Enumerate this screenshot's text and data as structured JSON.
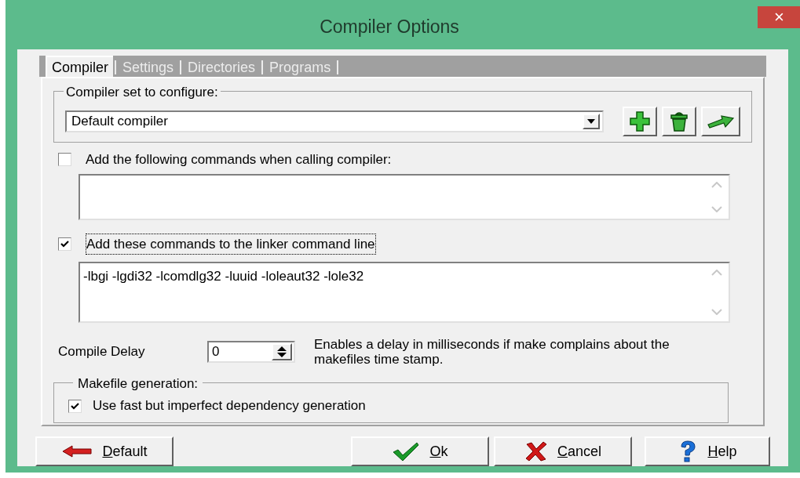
{
  "window": {
    "title": "Compiler Options",
    "close": "×"
  },
  "tabs": [
    {
      "label": "Compiler",
      "selected": true
    },
    {
      "label": "Settings",
      "selected": false
    },
    {
      "label": "Directories",
      "selected": false
    },
    {
      "label": "Programs",
      "selected": false
    }
  ],
  "compiler_set": {
    "label": "Compiler set to configure:",
    "value": "Default compiler"
  },
  "compile_commands": {
    "label": "Add the following commands when calling compiler:",
    "checked": false
  },
  "linker_commands": {
    "label": "Add these commands to the linker command line",
    "checked": true,
    "value": "-lbgi -lgdi32 -lcomdlg32 -luuid -loleaut32 -lole32"
  },
  "compile_delay": {
    "label": "Compile Delay",
    "value": "0",
    "description": "Enables a delay in milliseconds if make complains about the makefiles time stamp."
  },
  "makefile": {
    "label": "Makefile generation:",
    "option": {
      "label": "Use fast but imperfect dependency generation",
      "checked": true
    }
  },
  "buttons": [
    {
      "kind": "default",
      "label": "Default"
    },
    {
      "kind": "ok",
      "label": "Ok"
    },
    {
      "kind": "cancel",
      "label": "Cancel"
    },
    {
      "kind": "help",
      "label": "Help"
    }
  ]
}
